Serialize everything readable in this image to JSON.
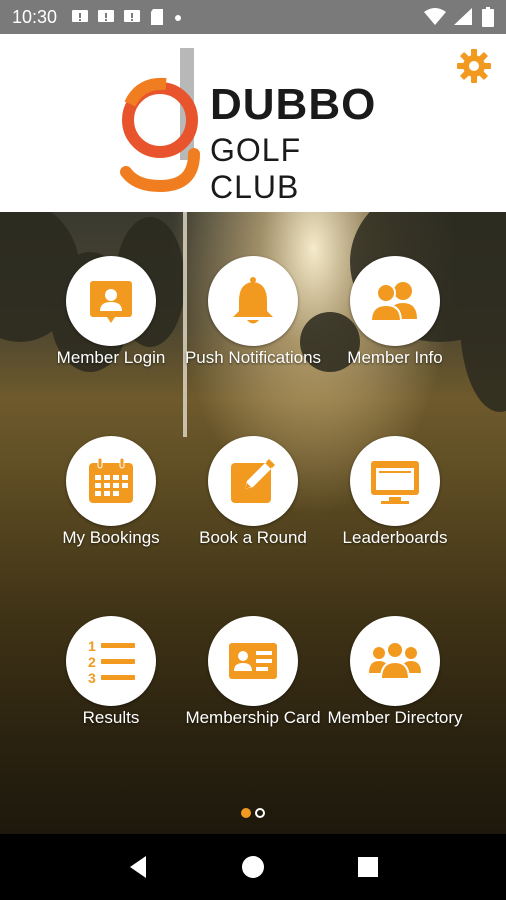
{
  "status_bar": {
    "time": "10:30",
    "left_icons": [
      "notification-icon",
      "notification-icon",
      "notification-icon",
      "sd-card-icon",
      "dot-icon"
    ],
    "right_icons": [
      "wifi-icon",
      "signal-icon",
      "battery-icon"
    ]
  },
  "header": {
    "logo_title": "DUBBO",
    "logo_subtitle": "GOLF CLUB",
    "settings_icon": "gear-icon"
  },
  "colors": {
    "accent": "#f29a1f",
    "logo_orange": "#f07d1f",
    "logo_red": "#e8552c",
    "logo_grey": "#b8b8b8",
    "status_bar": "#7a7a7a"
  },
  "tiles": [
    {
      "label": "Member Login",
      "icon": "id-badge-icon"
    },
    {
      "label": "Push Notifications",
      "icon": "bell-icon"
    },
    {
      "label": "Member Info",
      "icon": "users-icon"
    },
    {
      "label": "My Bookings",
      "icon": "calendar-icon"
    },
    {
      "label": "Book a Round",
      "icon": "edit-icon"
    },
    {
      "label": "Leaderboards",
      "icon": "monitor-icon"
    },
    {
      "label": "Results",
      "icon": "numbered-list-icon"
    },
    {
      "label": "Membership Card",
      "icon": "id-card-icon"
    },
    {
      "label": "Member Directory",
      "icon": "group-icon"
    }
  ],
  "pagination": {
    "current": 1,
    "total": 2
  },
  "nav_bar": {
    "icons": [
      "back-icon",
      "home-icon",
      "recents-icon"
    ]
  }
}
